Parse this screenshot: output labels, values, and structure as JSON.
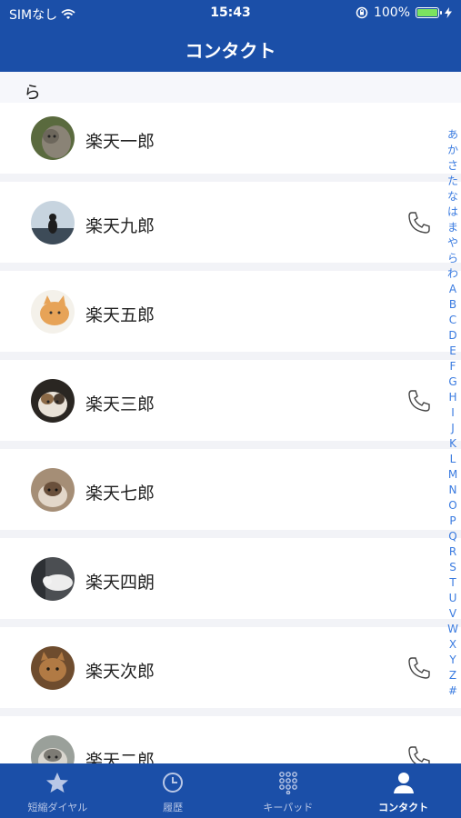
{
  "status_bar": {
    "carrier": "SIMなし",
    "time": "15:43",
    "battery": "100%"
  },
  "nav": {
    "title": "コンタクト"
  },
  "section": {
    "header": "ら"
  },
  "contacts": [
    {
      "name": "楽天一郎",
      "call": false
    },
    {
      "name": "楽天九郎",
      "call": true
    },
    {
      "name": "楽天五郎",
      "call": false
    },
    {
      "name": "楽天三郎",
      "call": true
    },
    {
      "name": "楽天七郎",
      "call": false
    },
    {
      "name": "楽天四朗",
      "call": false
    },
    {
      "name": "楽天次郎",
      "call": true
    },
    {
      "name": "楽天二郎",
      "call": true
    }
  ],
  "index": [
    "あ",
    "か",
    "さ",
    "た",
    "な",
    "は",
    "ま",
    "や",
    "ら",
    "わ",
    "A",
    "B",
    "C",
    "D",
    "E",
    "F",
    "G",
    "H",
    "I",
    "J",
    "K",
    "L",
    "M",
    "N",
    "O",
    "P",
    "Q",
    "R",
    "S",
    "T",
    "U",
    "V",
    "W",
    "X",
    "Y",
    "Z",
    "#"
  ],
  "tabs": [
    {
      "label": "短縮ダイヤル",
      "icon": "star-icon",
      "active": false
    },
    {
      "label": "履歴",
      "icon": "clock-icon",
      "active": false
    },
    {
      "label": "キーパッド",
      "icon": "keypad-icon",
      "active": false
    },
    {
      "label": "コンタクト",
      "icon": "person-icon",
      "active": true
    }
  ],
  "colors": {
    "brand_blue": "#1b4fa8",
    "index_blue": "#3a7be0",
    "battery_green": "#7be35f"
  }
}
